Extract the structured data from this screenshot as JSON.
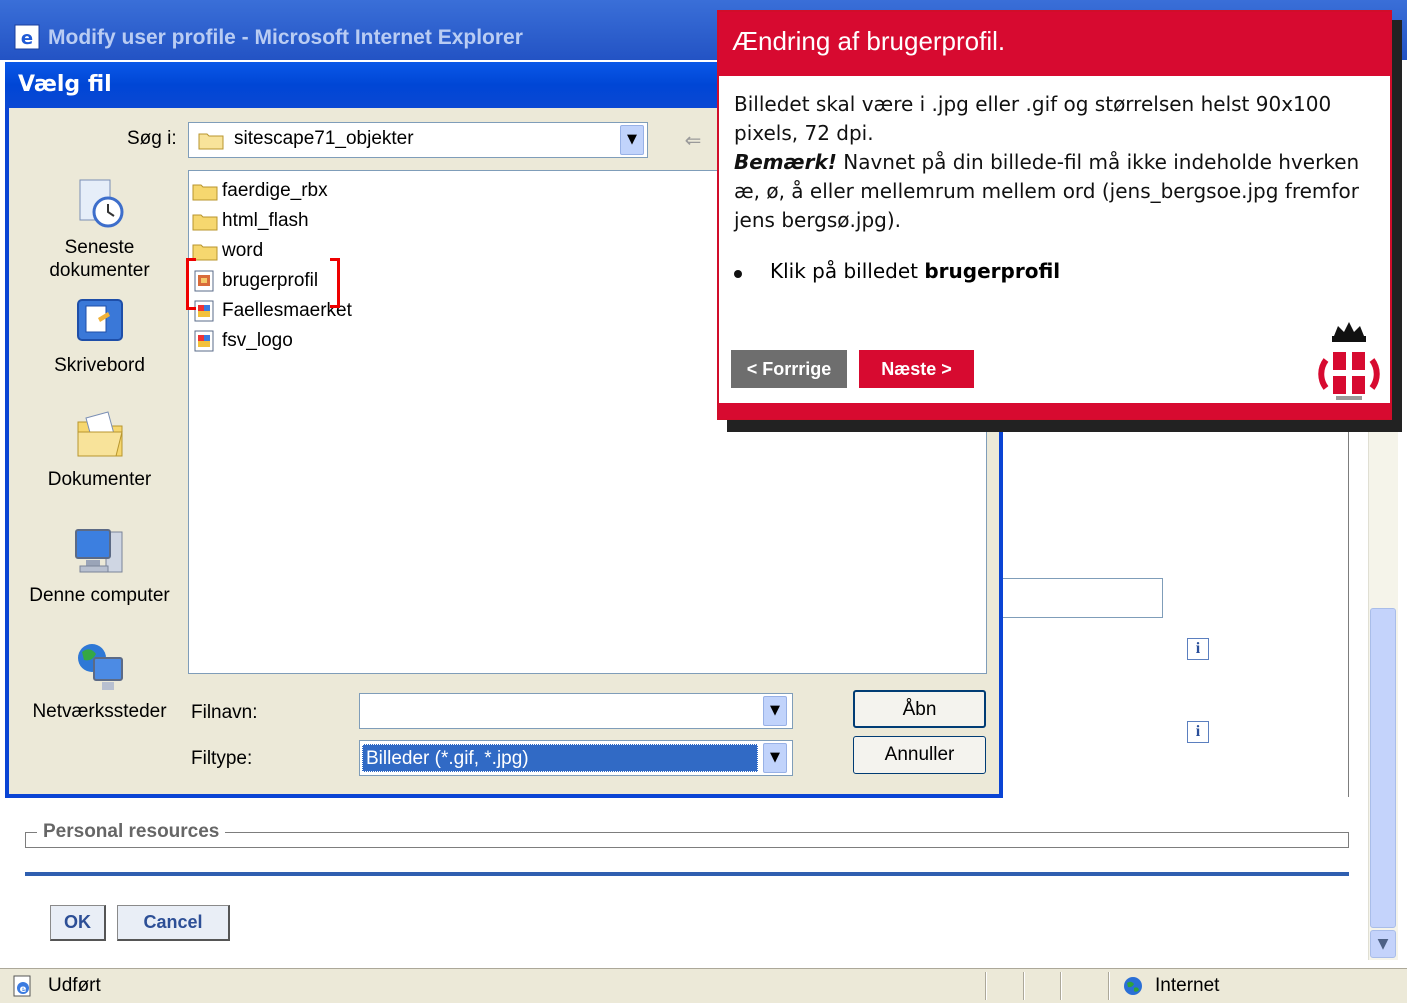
{
  "ie_window": {
    "title": "Modify user profile - Microsoft Internet Explorer"
  },
  "page": {
    "fieldset_legend": "Personal resources",
    "ok_label": "OK",
    "cancel_label": "Cancel",
    "info_glyph": "i"
  },
  "status_bar": {
    "status_text": "Udført",
    "zone_text": "Internet"
  },
  "file_dialog": {
    "title": "Vælg fil",
    "look_in_label": "Søg i:",
    "look_in_value": "sitescape71_objekter",
    "places": [
      {
        "label": "Seneste dokumenter",
        "icon": "recent-documents-icon"
      },
      {
        "label": "Skrivebord",
        "icon": "desktop-icon"
      },
      {
        "label": "Dokumenter",
        "icon": "my-documents-icon"
      },
      {
        "label": "Denne computer",
        "icon": "my-computer-icon"
      },
      {
        "label": "Netværkssteder",
        "icon": "network-places-icon"
      }
    ],
    "files": [
      {
        "name": "faerdige_rbx",
        "type": "folder"
      },
      {
        "name": "html_flash",
        "type": "folder"
      },
      {
        "name": "word",
        "type": "folder"
      },
      {
        "name": "brugerprofil",
        "type": "image"
      },
      {
        "name": "Faellesmaerket",
        "type": "image"
      },
      {
        "name": "fsv_logo",
        "type": "image"
      }
    ],
    "filename_label": "Filnavn:",
    "filename_value": "",
    "filetype_label": "Filtype:",
    "filetype_value": "Billeder (*.gif, *.jpg)",
    "open_label": "Åbn",
    "cancel_label": "Annuller"
  },
  "tutorial": {
    "title": "Ændring af brugerprofil.",
    "line1": "Billedet skal være i .jpg eller .gif og størrelsen helst 90x100 pixels, 72 dpi.",
    "note_label": "Bemærk!",
    "note_text": " Navnet på din billede-fil må ikke indeholde hverken æ, ø, å eller mellemrum mellem ord (jens_bergsoe.jpg fremfor jens bergsø.jpg).",
    "bullet_prefix": "Klik på billedet ",
    "bullet_bold": "brugerprofil",
    "prev_label": "< Forrrige",
    "next_label": "Næste >",
    "accent_color": "#d70a30"
  }
}
